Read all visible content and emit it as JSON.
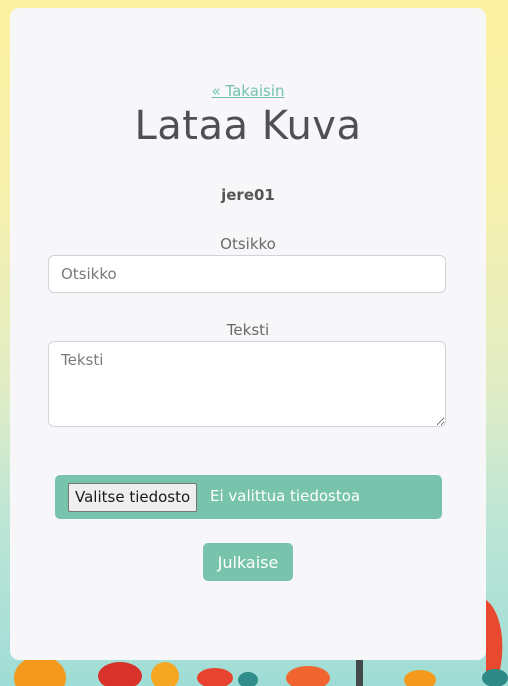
{
  "form": {
    "back_link": "« Takaisin",
    "title": "Lataa Kuva",
    "username": "jere01",
    "title_label": "Otsikko",
    "title_placeholder": "Otsikko",
    "text_label": "Teksti",
    "text_placeholder": "Teksti",
    "file_button_label": "Valitse tiedosto",
    "file_status": "Ei valittua tiedostoa",
    "submit_label": "Julkaise"
  },
  "colors": {
    "accent": "#77c3ac",
    "card": "#f7f7f9",
    "title_text": "#4f4f54"
  }
}
